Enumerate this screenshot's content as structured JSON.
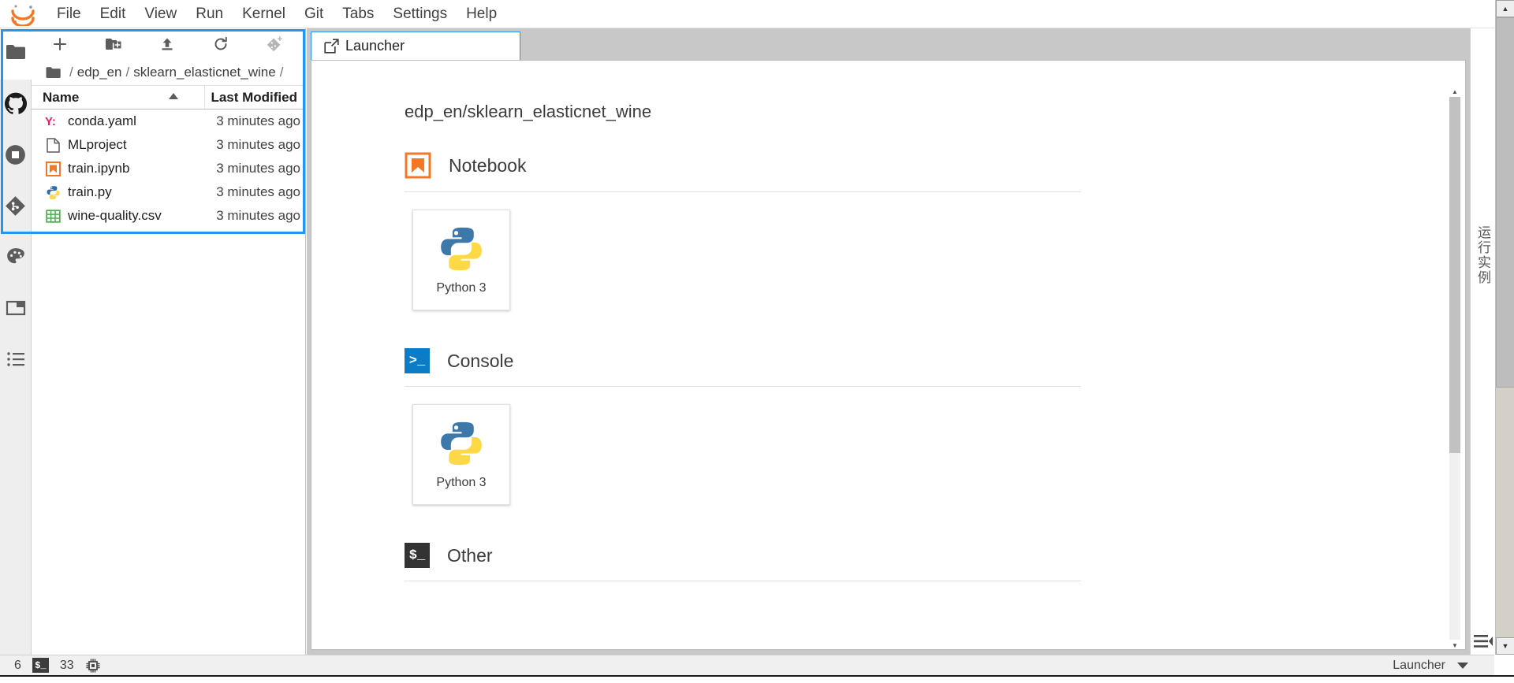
{
  "app": {
    "logo_icon": "jupyter-logo-icon"
  },
  "menubar": {
    "items": [
      {
        "label": "File",
        "name": "menu-file"
      },
      {
        "label": "Edit",
        "name": "menu-edit"
      },
      {
        "label": "View",
        "name": "menu-view"
      },
      {
        "label": "Run",
        "name": "menu-run"
      },
      {
        "label": "Kernel",
        "name": "menu-kernel"
      },
      {
        "label": "Git",
        "name": "menu-git"
      },
      {
        "label": "Tabs",
        "name": "menu-tabs"
      },
      {
        "label": "Settings",
        "name": "menu-settings"
      },
      {
        "label": "Help",
        "name": "menu-help"
      }
    ]
  },
  "activitybar": {
    "items": [
      {
        "icon": "folder-icon",
        "name": "sidebar-file-browser",
        "active": true
      },
      {
        "icon": "github-icon",
        "name": "sidebar-github"
      },
      {
        "icon": "running-stop-icon",
        "name": "sidebar-running-terminals"
      },
      {
        "icon": "git-icon",
        "name": "sidebar-git"
      },
      {
        "icon": "palette-icon",
        "name": "sidebar-extension-manager"
      },
      {
        "icon": "property-inspector-icon",
        "name": "sidebar-property-inspector"
      },
      {
        "icon": "table-of-contents-icon",
        "name": "sidebar-table-of-contents"
      }
    ]
  },
  "filebrowser": {
    "toolbar": [
      {
        "icon": "plus-icon",
        "name": "new-launcher-button",
        "title": "+"
      },
      {
        "icon": "new-folder-icon",
        "name": "new-folder-button"
      },
      {
        "icon": "upload-icon",
        "name": "upload-files-button"
      },
      {
        "icon": "refresh-icon",
        "name": "refresh-file-list-button"
      },
      {
        "icon": "git-clone-icon",
        "name": "git-clone-button"
      }
    ],
    "breadcrumb": {
      "home_icon": "folder-icon",
      "segments": [
        "edp_en",
        "sklearn_elasticnet_wine"
      ]
    },
    "columns": {
      "name": "Name",
      "last_modified": "Last Modified",
      "sort_direction": "asc"
    },
    "files": [
      {
        "icon": "yaml-file-icon",
        "name": "conda.yaml",
        "modified": "3 minutes ago"
      },
      {
        "icon": "generic-file-icon",
        "name": "MLproject",
        "modified": "3 minutes ago"
      },
      {
        "icon": "notebook-file-icon",
        "name": "train.ipynb",
        "modified": "3 minutes ago"
      },
      {
        "icon": "python-file-icon",
        "name": "train.py",
        "modified": "3 minutes ago"
      },
      {
        "icon": "csv-file-icon",
        "name": "wine-quality.csv",
        "modified": "3 minutes ago"
      }
    ]
  },
  "dock": {
    "tabs": [
      {
        "label": "Launcher",
        "icon": "launcher-icon",
        "name": "tab-launcher",
        "active": true
      }
    ]
  },
  "launcher": {
    "path_title": "edp_en/sklearn_elasticnet_wine",
    "sections": [
      {
        "label": "Notebook",
        "icon": "notebook-icon",
        "cards": [
          {
            "label": "Python 3",
            "icon": "python-icon",
            "name": "launcher-card-notebook-python3"
          }
        ]
      },
      {
        "label": "Console",
        "icon": "console-icon",
        "icon_text": ">_",
        "cards": [
          {
            "label": "Python 3",
            "icon": "python-icon",
            "name": "launcher-card-console-python3"
          }
        ]
      },
      {
        "label": "Other",
        "icon": "other-terminal-icon",
        "icon_text": "$_",
        "cards": []
      }
    ]
  },
  "rightbar": {
    "label": "运行实例",
    "bottom_icon": "toggle-right-sidebar-icon"
  },
  "statusbar": {
    "left": [
      {
        "type": "text",
        "value": "6",
        "name": "status-kernel-count"
      },
      {
        "type": "icon",
        "value": "$_",
        "name": "status-terminal-icon"
      },
      {
        "type": "text",
        "value": "33",
        "name": "status-terminal-count"
      },
      {
        "type": "icon",
        "value": "cpu-icon",
        "name": "status-resource-usage-icon"
      }
    ],
    "right": [
      {
        "type": "text",
        "value": "Launcher",
        "name": "status-active-tab-label"
      },
      {
        "type": "icon",
        "value": "chevron-down-icon",
        "name": "status-expand-icon"
      }
    ]
  },
  "colors": {
    "accent_blue": "#2196f3",
    "jupyter_orange": "#f37726",
    "console_blue": "#0b7cc5",
    "other_dark": "#333333",
    "yaml_pink": "#e91e63",
    "python_blue": "#3c78aa",
    "python_yellow": "#ffd845",
    "csv_green": "#4caf50"
  }
}
